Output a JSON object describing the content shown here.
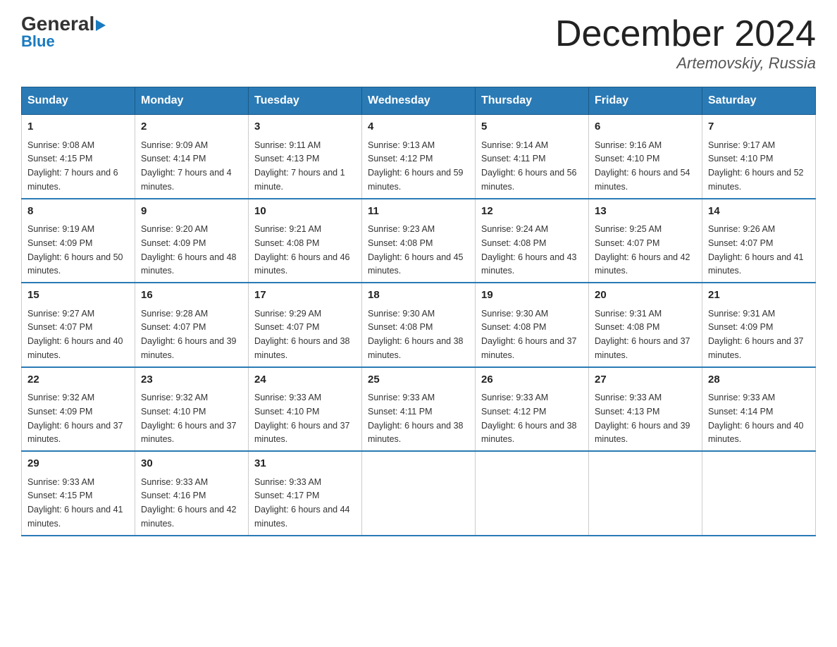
{
  "header": {
    "logo_general": "General",
    "logo_blue": "Blue",
    "month_year": "December 2024",
    "location": "Artemovskiy, Russia"
  },
  "days_of_week": [
    "Sunday",
    "Monday",
    "Tuesday",
    "Wednesday",
    "Thursday",
    "Friday",
    "Saturday"
  ],
  "weeks": [
    [
      {
        "day": "1",
        "sunrise": "9:08 AM",
        "sunset": "4:15 PM",
        "daylight": "7 hours and 6 minutes."
      },
      {
        "day": "2",
        "sunrise": "9:09 AM",
        "sunset": "4:14 PM",
        "daylight": "7 hours and 4 minutes."
      },
      {
        "day": "3",
        "sunrise": "9:11 AM",
        "sunset": "4:13 PM",
        "daylight": "7 hours and 1 minute."
      },
      {
        "day": "4",
        "sunrise": "9:13 AM",
        "sunset": "4:12 PM",
        "daylight": "6 hours and 59 minutes."
      },
      {
        "day": "5",
        "sunrise": "9:14 AM",
        "sunset": "4:11 PM",
        "daylight": "6 hours and 56 minutes."
      },
      {
        "day": "6",
        "sunrise": "9:16 AM",
        "sunset": "4:10 PM",
        "daylight": "6 hours and 54 minutes."
      },
      {
        "day": "7",
        "sunrise": "9:17 AM",
        "sunset": "4:10 PM",
        "daylight": "6 hours and 52 minutes."
      }
    ],
    [
      {
        "day": "8",
        "sunrise": "9:19 AM",
        "sunset": "4:09 PM",
        "daylight": "6 hours and 50 minutes."
      },
      {
        "day": "9",
        "sunrise": "9:20 AM",
        "sunset": "4:09 PM",
        "daylight": "6 hours and 48 minutes."
      },
      {
        "day": "10",
        "sunrise": "9:21 AM",
        "sunset": "4:08 PM",
        "daylight": "6 hours and 46 minutes."
      },
      {
        "day": "11",
        "sunrise": "9:23 AM",
        "sunset": "4:08 PM",
        "daylight": "6 hours and 45 minutes."
      },
      {
        "day": "12",
        "sunrise": "9:24 AM",
        "sunset": "4:08 PM",
        "daylight": "6 hours and 43 minutes."
      },
      {
        "day": "13",
        "sunrise": "9:25 AM",
        "sunset": "4:07 PM",
        "daylight": "6 hours and 42 minutes."
      },
      {
        "day": "14",
        "sunrise": "9:26 AM",
        "sunset": "4:07 PM",
        "daylight": "6 hours and 41 minutes."
      }
    ],
    [
      {
        "day": "15",
        "sunrise": "9:27 AM",
        "sunset": "4:07 PM",
        "daylight": "6 hours and 40 minutes."
      },
      {
        "day": "16",
        "sunrise": "9:28 AM",
        "sunset": "4:07 PM",
        "daylight": "6 hours and 39 minutes."
      },
      {
        "day": "17",
        "sunrise": "9:29 AM",
        "sunset": "4:07 PM",
        "daylight": "6 hours and 38 minutes."
      },
      {
        "day": "18",
        "sunrise": "9:30 AM",
        "sunset": "4:08 PM",
        "daylight": "6 hours and 38 minutes."
      },
      {
        "day": "19",
        "sunrise": "9:30 AM",
        "sunset": "4:08 PM",
        "daylight": "6 hours and 37 minutes."
      },
      {
        "day": "20",
        "sunrise": "9:31 AM",
        "sunset": "4:08 PM",
        "daylight": "6 hours and 37 minutes."
      },
      {
        "day": "21",
        "sunrise": "9:31 AM",
        "sunset": "4:09 PM",
        "daylight": "6 hours and 37 minutes."
      }
    ],
    [
      {
        "day": "22",
        "sunrise": "9:32 AM",
        "sunset": "4:09 PM",
        "daylight": "6 hours and 37 minutes."
      },
      {
        "day": "23",
        "sunrise": "9:32 AM",
        "sunset": "4:10 PM",
        "daylight": "6 hours and 37 minutes."
      },
      {
        "day": "24",
        "sunrise": "9:33 AM",
        "sunset": "4:10 PM",
        "daylight": "6 hours and 37 minutes."
      },
      {
        "day": "25",
        "sunrise": "9:33 AM",
        "sunset": "4:11 PM",
        "daylight": "6 hours and 38 minutes."
      },
      {
        "day": "26",
        "sunrise": "9:33 AM",
        "sunset": "4:12 PM",
        "daylight": "6 hours and 38 minutes."
      },
      {
        "day": "27",
        "sunrise": "9:33 AM",
        "sunset": "4:13 PM",
        "daylight": "6 hours and 39 minutes."
      },
      {
        "day": "28",
        "sunrise": "9:33 AM",
        "sunset": "4:14 PM",
        "daylight": "6 hours and 40 minutes."
      }
    ],
    [
      {
        "day": "29",
        "sunrise": "9:33 AM",
        "sunset": "4:15 PM",
        "daylight": "6 hours and 41 minutes."
      },
      {
        "day": "30",
        "sunrise": "9:33 AM",
        "sunset": "4:16 PM",
        "daylight": "6 hours and 42 minutes."
      },
      {
        "day": "31",
        "sunrise": "9:33 AM",
        "sunset": "4:17 PM",
        "daylight": "6 hours and 44 minutes."
      },
      null,
      null,
      null,
      null
    ]
  ],
  "labels": {
    "sunrise": "Sunrise:",
    "sunset": "Sunset:",
    "daylight": "Daylight:"
  }
}
